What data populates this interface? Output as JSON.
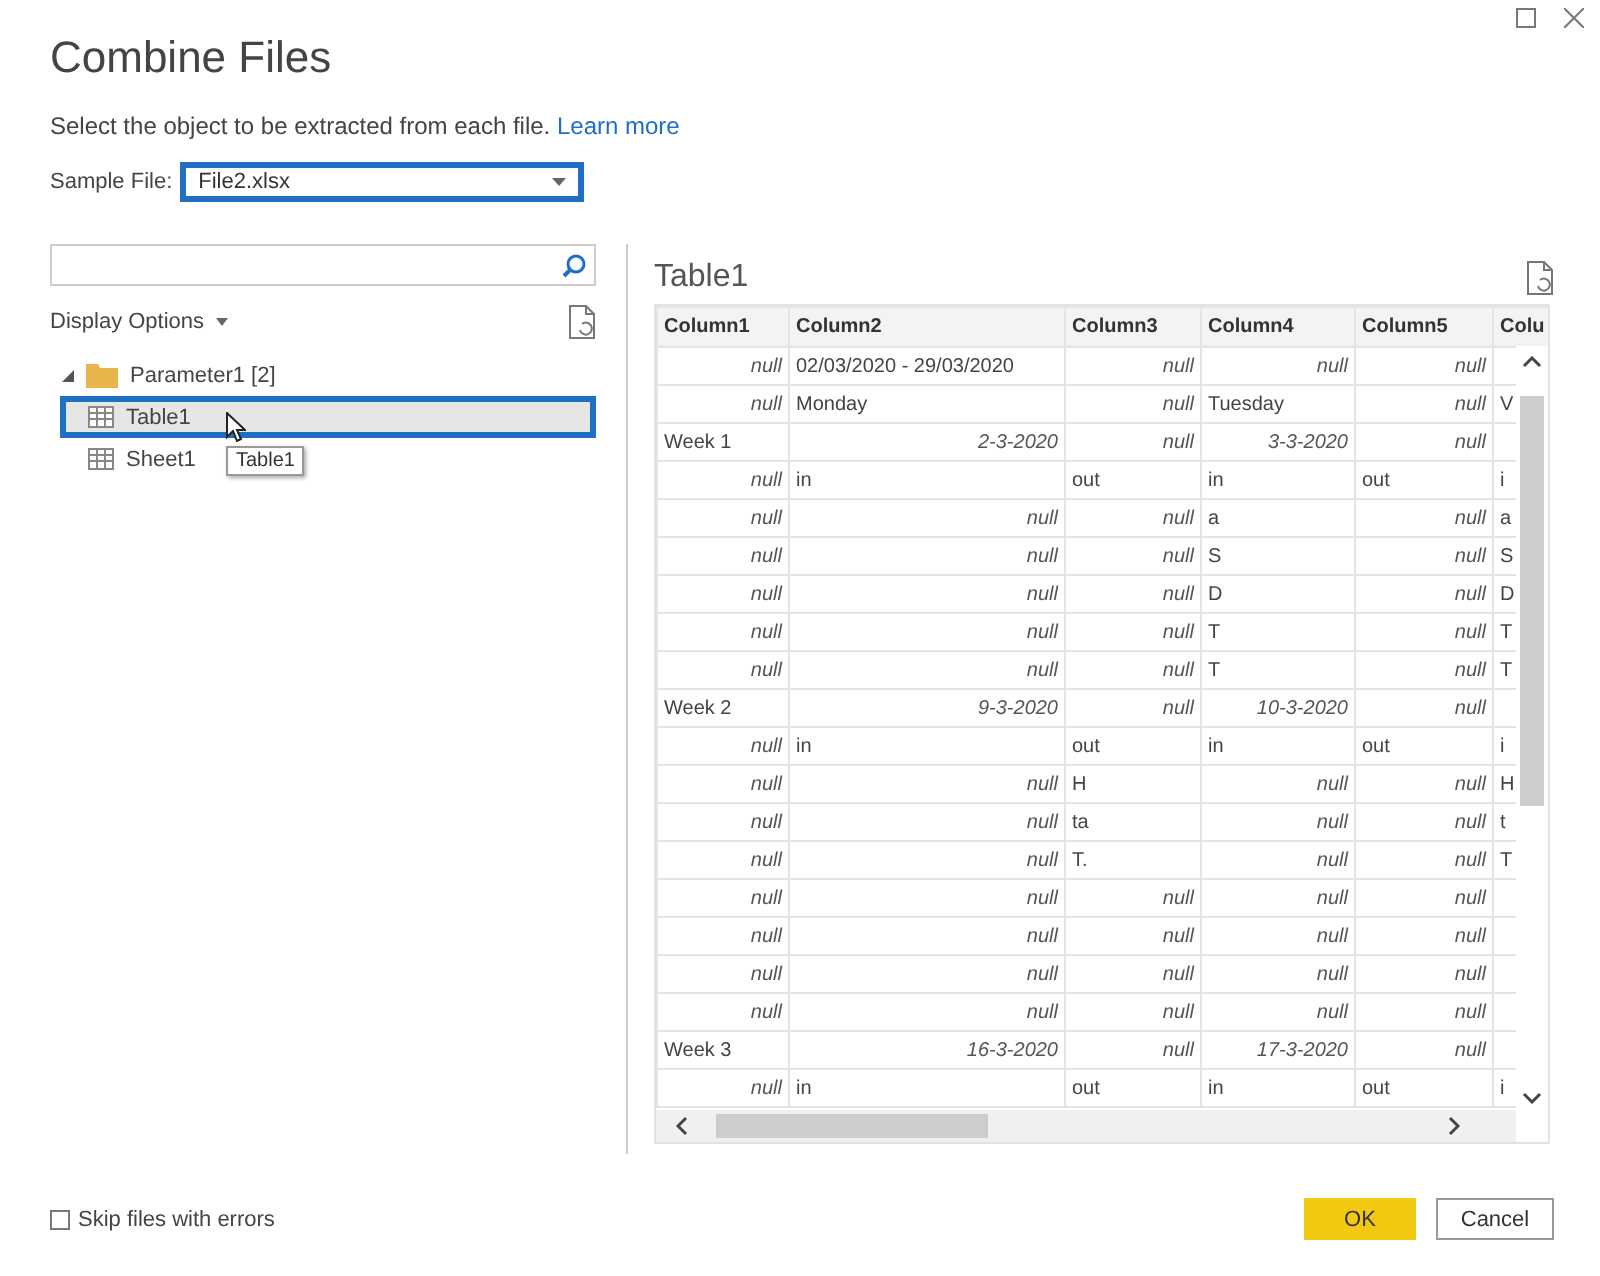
{
  "window": {
    "title": "Combine Files"
  },
  "instruction": {
    "text": "Select the object to be extracted from each file.",
    "link": "Learn more"
  },
  "sample_file": {
    "label": "Sample File:",
    "value": "File2.xlsx",
    "focused": true
  },
  "navigator": {
    "display_options": "Display Options",
    "tree": [
      {
        "label": "Parameter1 [2]",
        "expanded": true,
        "children": [
          {
            "label": "Table1",
            "selected": true
          },
          {
            "label": "Sheet1",
            "selected": false
          }
        ]
      }
    ],
    "tooltip": "Table1"
  },
  "preview": {
    "title": "Table1",
    "columns": [
      "Column1",
      "Column2",
      "Column3",
      "Column4",
      "Column5",
      "Colu"
    ],
    "rows": [
      {
        "cells": [
          {
            "text": "null",
            "kind": "value"
          },
          {
            "text": "02/03/2020 - 29/03/2020",
            "kind": "label"
          },
          {
            "text": "null",
            "kind": "value"
          },
          {
            "text": "null",
            "kind": "value"
          },
          {
            "text": "null",
            "kind": "value"
          }
        ]
      },
      {
        "cells": [
          {
            "text": "null",
            "kind": "value"
          },
          {
            "text": "Monday",
            "kind": "label"
          },
          {
            "text": "null",
            "kind": "value"
          },
          {
            "text": "Tuesday",
            "kind": "label"
          },
          {
            "text": "null",
            "kind": "value"
          },
          {
            "text": "V",
            "kind": "label"
          }
        ]
      },
      {
        "cells": [
          {
            "text": "Week 1",
            "kind": "label"
          },
          {
            "text": "2-3-2020",
            "kind": "value"
          },
          {
            "text": "null",
            "kind": "value"
          },
          {
            "text": "3-3-2020",
            "kind": "value"
          },
          {
            "text": "null",
            "kind": "value"
          }
        ]
      },
      {
        "cells": [
          {
            "text": "null",
            "kind": "value"
          },
          {
            "text": "in",
            "kind": "label"
          },
          {
            "text": "out",
            "kind": "label"
          },
          {
            "text": "in",
            "kind": "label"
          },
          {
            "text": "out",
            "kind": "label"
          },
          {
            "text": "i",
            "kind": "label"
          }
        ]
      },
      {
        "cells": [
          {
            "text": "null",
            "kind": "value"
          },
          {
            "text": "null",
            "kind": "value"
          },
          {
            "text": "null",
            "kind": "value"
          },
          {
            "text": "a",
            "kind": "label"
          },
          {
            "text": "null",
            "kind": "value"
          },
          {
            "text": "a",
            "kind": "label"
          }
        ]
      },
      {
        "cells": [
          {
            "text": "null",
            "kind": "value"
          },
          {
            "text": "null",
            "kind": "value"
          },
          {
            "text": "null",
            "kind": "value"
          },
          {
            "text": "S",
            "kind": "label"
          },
          {
            "text": "null",
            "kind": "value"
          },
          {
            "text": "S",
            "kind": "label"
          }
        ]
      },
      {
        "cells": [
          {
            "text": "null",
            "kind": "value"
          },
          {
            "text": "null",
            "kind": "value"
          },
          {
            "text": "null",
            "kind": "value"
          },
          {
            "text": "D",
            "kind": "label"
          },
          {
            "text": "null",
            "kind": "value"
          },
          {
            "text": "D",
            "kind": "label"
          }
        ]
      },
      {
        "cells": [
          {
            "text": "null",
            "kind": "value"
          },
          {
            "text": "null",
            "kind": "value"
          },
          {
            "text": "null",
            "kind": "value"
          },
          {
            "text": "T",
            "kind": "label"
          },
          {
            "text": "null",
            "kind": "value"
          },
          {
            "text": "T",
            "kind": "label"
          }
        ]
      },
      {
        "cells": [
          {
            "text": "null",
            "kind": "value"
          },
          {
            "text": "null",
            "kind": "value"
          },
          {
            "text": "null",
            "kind": "value"
          },
          {
            "text": "T",
            "kind": "label"
          },
          {
            "text": "null",
            "kind": "value"
          },
          {
            "text": "T",
            "kind": "label"
          }
        ]
      },
      {
        "cells": [
          {
            "text": "Week 2",
            "kind": "label"
          },
          {
            "text": "9-3-2020",
            "kind": "value"
          },
          {
            "text": "null",
            "kind": "value"
          },
          {
            "text": "10-3-2020",
            "kind": "value"
          },
          {
            "text": "null",
            "kind": "value"
          }
        ]
      },
      {
        "cells": [
          {
            "text": "null",
            "kind": "value"
          },
          {
            "text": "in",
            "kind": "label"
          },
          {
            "text": "out",
            "kind": "label"
          },
          {
            "text": "in",
            "kind": "label"
          },
          {
            "text": "out",
            "kind": "label"
          },
          {
            "text": "i",
            "kind": "label"
          }
        ]
      },
      {
        "cells": [
          {
            "text": "null",
            "kind": "value"
          },
          {
            "text": "null",
            "kind": "value"
          },
          {
            "text": "H",
            "kind": "label"
          },
          {
            "text": "null",
            "kind": "value"
          },
          {
            "text": "null",
            "kind": "value"
          },
          {
            "text": "H",
            "kind": "label"
          }
        ]
      },
      {
        "cells": [
          {
            "text": "null",
            "kind": "value"
          },
          {
            "text": "null",
            "kind": "value"
          },
          {
            "text": "ta",
            "kind": "label"
          },
          {
            "text": "null",
            "kind": "value"
          },
          {
            "text": "null",
            "kind": "value"
          },
          {
            "text": "t",
            "kind": "label"
          }
        ]
      },
      {
        "cells": [
          {
            "text": "null",
            "kind": "value"
          },
          {
            "text": "null",
            "kind": "value"
          },
          {
            "text": "T.",
            "kind": "label"
          },
          {
            "text": "null",
            "kind": "value"
          },
          {
            "text": "null",
            "kind": "value"
          },
          {
            "text": "T",
            "kind": "label"
          }
        ]
      },
      {
        "cells": [
          {
            "text": "null",
            "kind": "value"
          },
          {
            "text": "null",
            "kind": "value"
          },
          {
            "text": "null",
            "kind": "value"
          },
          {
            "text": "null",
            "kind": "value"
          },
          {
            "text": "null",
            "kind": "value"
          }
        ]
      },
      {
        "cells": [
          {
            "text": "null",
            "kind": "value"
          },
          {
            "text": "null",
            "kind": "value"
          },
          {
            "text": "null",
            "kind": "value"
          },
          {
            "text": "null",
            "kind": "value"
          },
          {
            "text": "null",
            "kind": "value"
          }
        ]
      },
      {
        "cells": [
          {
            "text": "null",
            "kind": "value"
          },
          {
            "text": "null",
            "kind": "value"
          },
          {
            "text": "null",
            "kind": "value"
          },
          {
            "text": "null",
            "kind": "value"
          },
          {
            "text": "null",
            "kind": "value"
          }
        ]
      },
      {
        "cells": [
          {
            "text": "null",
            "kind": "value"
          },
          {
            "text": "null",
            "kind": "value"
          },
          {
            "text": "null",
            "kind": "value"
          },
          {
            "text": "null",
            "kind": "value"
          },
          {
            "text": "null",
            "kind": "value"
          }
        ]
      },
      {
        "cells": [
          {
            "text": "Week 3",
            "kind": "label"
          },
          {
            "text": "16-3-2020",
            "kind": "value"
          },
          {
            "text": "null",
            "kind": "value"
          },
          {
            "text": "17-3-2020",
            "kind": "value"
          },
          {
            "text": "null",
            "kind": "value"
          }
        ]
      },
      {
        "cells": [
          {
            "text": "null",
            "kind": "value"
          },
          {
            "text": "in",
            "kind": "label"
          },
          {
            "text": "out",
            "kind": "label"
          },
          {
            "text": "in",
            "kind": "label"
          },
          {
            "text": "out",
            "kind": "label"
          },
          {
            "text": "i",
            "kind": "label"
          }
        ]
      }
    ]
  },
  "skip_errors": {
    "label": "Skip files with errors",
    "checked": false
  },
  "buttons": [
    {
      "label": "OK",
      "kind": "primary"
    },
    {
      "label": "Cancel",
      "kind": "secondary"
    }
  ]
}
